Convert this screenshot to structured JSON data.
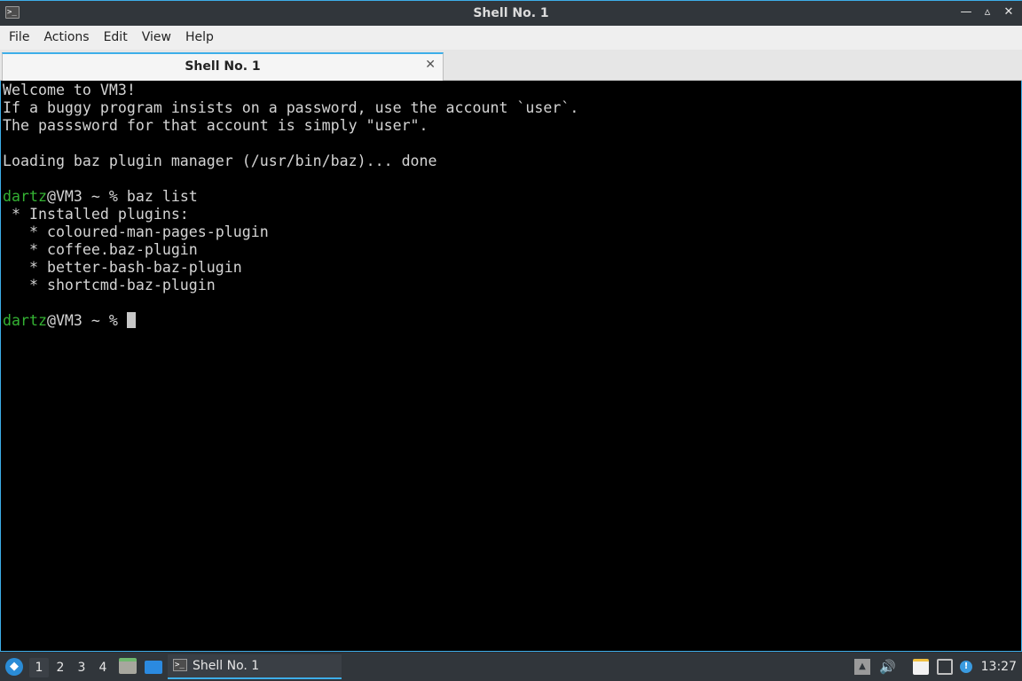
{
  "window": {
    "title": "Shell No. 1",
    "icon": "terminal-icon",
    "controls": [
      "minimize-icon",
      "restore-icon",
      "close-icon"
    ],
    "control_glyphs": [
      "—",
      "▵",
      "✕"
    ]
  },
  "menubar": {
    "items": [
      "File",
      "Actions",
      "Edit",
      "View",
      "Help"
    ]
  },
  "tabs": [
    {
      "label": "Shell No. 1",
      "close_glyph": "✕"
    }
  ],
  "terminal": {
    "lines": [
      {
        "text": "Welcome to VM3!"
      },
      {
        "text": "If a buggy program insists on a password, use the account `user`."
      },
      {
        "text": "The passsword for that account is simply \"user\"."
      },
      {
        "text": ""
      },
      {
        "text": "Loading baz plugin manager (/usr/bin/baz)... done"
      },
      {
        "text": ""
      },
      {
        "prompt_user": "dartz",
        "prompt_rest": "@VM3 ~ % ",
        "command": "baz list"
      },
      {
        "text": " * Installed plugins:"
      },
      {
        "text": "   * coloured-man-pages-plugin"
      },
      {
        "text": "   * coffee.baz-plugin"
      },
      {
        "text": "   * better-bash-baz-plugin"
      },
      {
        "text": "   * shortcmd-baz-plugin"
      },
      {
        "text": ""
      },
      {
        "prompt_user": "dartz",
        "prompt_rest": "@VM3 ~ % ",
        "command": "",
        "cursor": true
      }
    ],
    "colors": {
      "background": "#000000",
      "foreground": "#d4d4d4",
      "prompt_user": "#34b233"
    }
  },
  "taskbar": {
    "desktops": [
      "1",
      "2",
      "3",
      "4"
    ],
    "active_desktop": "1",
    "task_label": "Shell No. 1",
    "clock": "13:27",
    "tray_icons": [
      "tray-arrow-icon",
      "volume-icon",
      "clipboard-icon",
      "network-icon",
      "update-notifier-icon"
    ]
  }
}
